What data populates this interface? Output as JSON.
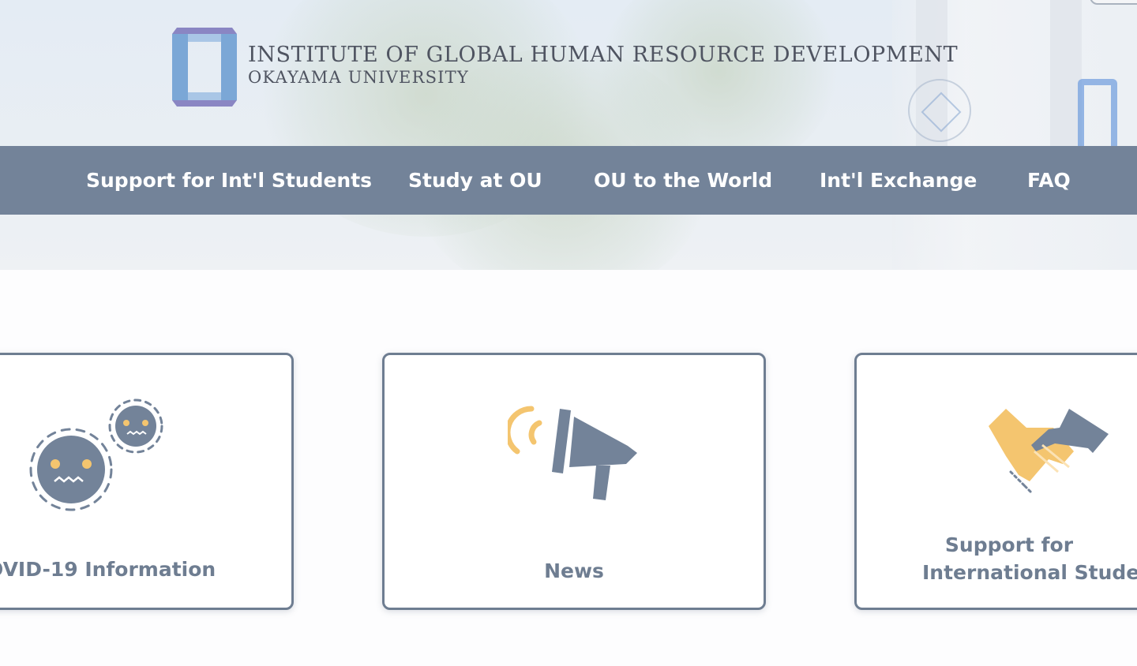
{
  "header": {
    "title": "INSTITUTE OF GLOBAL HUMAN RESOURCE DEVELOPMENT",
    "subtitle": "OKAYAMA UNIVERSITY"
  },
  "nav": {
    "items": [
      {
        "label": "Support for Int'l Students"
      },
      {
        "label": "Study at OU"
      },
      {
        "label": "OU to the World"
      },
      {
        "label": "Int'l Exchange"
      },
      {
        "label": "FAQ"
      }
    ]
  },
  "cards": [
    {
      "label": "OVID-19 Information",
      "icon": "virus-icon"
    },
    {
      "label": "News",
      "icon": "megaphone-icon"
    },
    {
      "label_line1": "Support for",
      "label_line2": "International Stude",
      "icon": "handshake-icon"
    }
  ],
  "colors": {
    "nav_bg": "#738399",
    "card_border": "#6e7d91",
    "accent_yellow": "#f4c56f",
    "logo_blue": "#7ba7d6",
    "logo_purple": "#8a86c3",
    "brand_text": "#4f5461"
  }
}
